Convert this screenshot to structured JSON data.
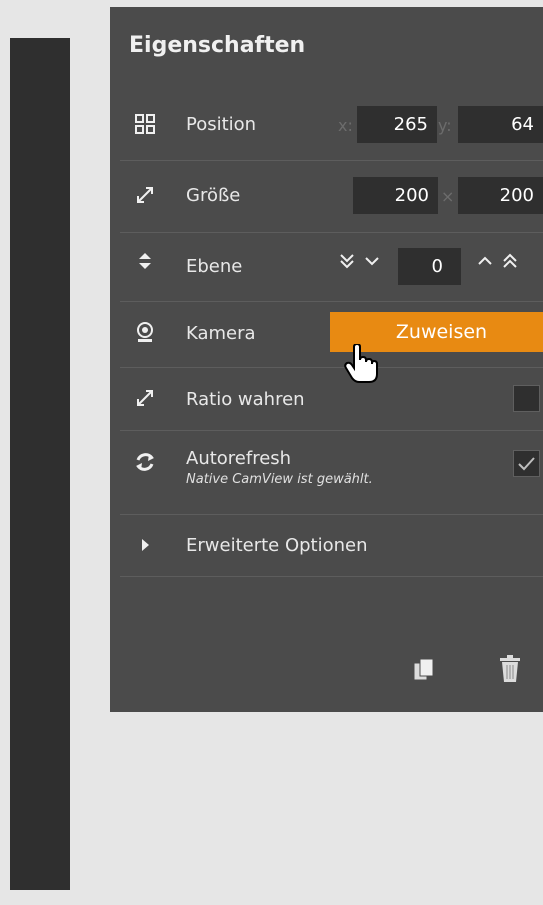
{
  "panel": {
    "title": "Eigenschaften",
    "position": {
      "label": "Position",
      "x_label": "x:",
      "x_value": "265",
      "y_label": "y:",
      "y_value": "64"
    },
    "size": {
      "label": "Größe",
      "w_value": "200",
      "times": "×",
      "h_value": "200"
    },
    "layer": {
      "label": "Ebene",
      "value": "0"
    },
    "camera": {
      "label": "Kamera",
      "assign_label": "Zuweisen"
    },
    "ratio": {
      "label": "Ratio wahren",
      "checked": false
    },
    "autorefresh": {
      "label": "Autorefresh",
      "note": "Native CamView ist gewählt.",
      "checked": true
    },
    "advanced": {
      "label": "Erweiterte Optionen"
    }
  },
  "icons": {
    "position": "move-arrows-icon",
    "size": "expand-diagonal-icon",
    "layer": "up-down-caret-icon",
    "camera": "webcam-icon",
    "ratio": "expand-diagonal-icon",
    "autorefresh": "refresh-icon",
    "advanced": "caret-right-icon",
    "copy": "copy-icon",
    "delete": "trash-icon",
    "cursor": "hand-pointer-icon"
  },
  "colors": {
    "accent": "#e88a12",
    "panel": "#4b4b4b",
    "input": "#2f2f2f"
  }
}
